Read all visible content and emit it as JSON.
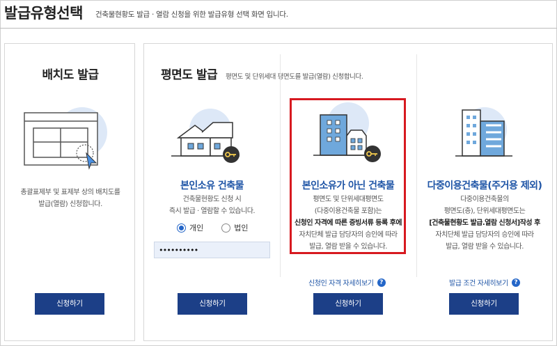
{
  "header": {
    "title": "발급유형선택",
    "description": "건축물현황도 발급 · 열람 신청을 위한 발급유형 선택 화면 입니다."
  },
  "site_plan": {
    "title": "배치도 발급",
    "description_line1": "총괄표제부 및 표제부 상의 배치도를",
    "description_line2": "발급(열람) 신청합니다.",
    "button": "신청하기"
  },
  "floor_plan": {
    "title": "평면도 발급",
    "subtitle": "평면도 및 단위세대 평면도를 발급(열람) 신청합니다.",
    "cards": [
      {
        "title": "본인소유 건축물",
        "desc1": "건축물현황도 신청 시",
        "desc2": "즉시 발급 · 열람할 수 있습니다.",
        "radio_individual": "개인",
        "radio_corporation": "법인",
        "password_value": "••••••••••",
        "button": "신청하기"
      },
      {
        "title": "본인소유가 아닌 건축물",
        "desc1": "평면도 및 단위세대평면도",
        "desc2": "(다중이용건축물 포함)는",
        "desc3_bold": "신청인 자격에 따른 증빙서류 등록 후에",
        "desc4": "자치단체 발급 담당자의 승인에 따라",
        "desc5": "발급, 열람 받을 수 있습니다.",
        "link": "신청인 자격 자세히보기",
        "button": "신청하기"
      },
      {
        "title": "다중이용건축물(주거용 제외)",
        "desc1": "다중이용건축물의",
        "desc2": "평면도(층), 단위세대평면도는",
        "desc3_bold": "[건축물현황도 발급.열람 신청서]작성 후",
        "desc4": "자치단체 발급 담당자의 승인에 따라",
        "desc5": "발급, 열람 받을 수 있습니다.",
        "link": "발급 조건 자세히보기",
        "button": "신청하기"
      }
    ]
  },
  "icons": {
    "help": "?"
  },
  "colors": {
    "button": "#1c3f87",
    "accent_text": "#1f55a6",
    "highlight": "#d71920",
    "illustration_bg": "#dde8f7"
  }
}
